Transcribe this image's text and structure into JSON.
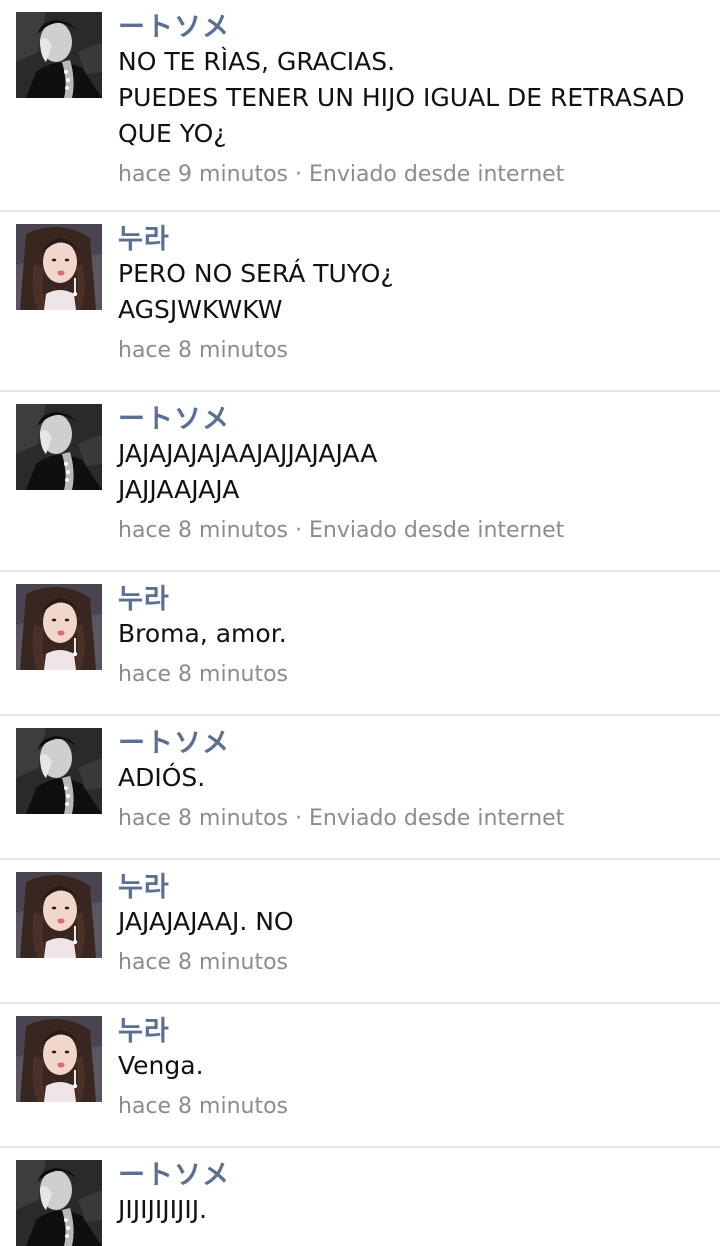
{
  "messages": [
    {
      "author": "ートソメ",
      "avatar": "man-avatar",
      "lines": [
        "NO TE RÌAS, GRACIAS.",
        "PUEDES TENER UN HIJO IGUAL DE RETRASAD",
        "QUE YO¿"
      ],
      "meta": "hace 9 minutos · Enviado desde internet"
    },
    {
      "author": "누라",
      "avatar": "woman-avatar",
      "lines": [
        "PERO NO SERÁ TUYO¿",
        "AGSJWKWKW"
      ],
      "meta": "hace 8 minutos"
    },
    {
      "author": "ートソメ",
      "avatar": "man-avatar",
      "lines": [
        "JAJAJAJAJAAJAJJAJAJAA",
        "JAJJAAJAJA"
      ],
      "meta": "hace 8 minutos · Enviado desde internet"
    },
    {
      "author": "누라",
      "avatar": "woman-avatar",
      "lines": [
        "Broma, amor."
      ],
      "meta": "hace 8 minutos"
    },
    {
      "author": "ートソメ",
      "avatar": "man-avatar",
      "lines": [
        "ADIÓS."
      ],
      "meta": "hace 8 minutos · Enviado desde internet"
    },
    {
      "author": "누라",
      "avatar": "woman-avatar",
      "lines": [
        "JAJAJAJAAJ. NO"
      ],
      "meta": "hace 8 minutos"
    },
    {
      "author": "누라",
      "avatar": "woman-avatar",
      "lines": [
        "Venga."
      ],
      "meta": "hace 8 minutos"
    },
    {
      "author": "ートソメ",
      "avatar": "man-avatar",
      "lines": [
        "JIJIJIJIJIJ."
      ],
      "meta": ""
    }
  ]
}
